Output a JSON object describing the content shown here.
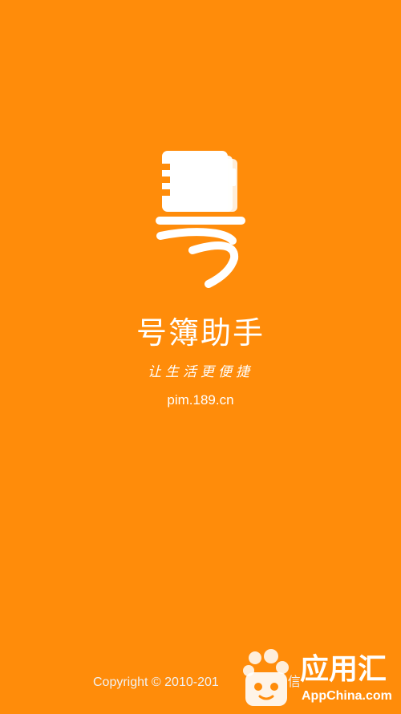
{
  "splash": {
    "logo_icon": "notebook-phone-logo-icon",
    "app_name": "号簿助手",
    "slogan": "让生活更便捷",
    "website": "pim.189.cn",
    "copyright": "Copyright © 2010-201",
    "copyright_tail": "信"
  },
  "watermark": {
    "icon": "appchina-logo-icon",
    "name": "应用汇",
    "site": "AppChina.com"
  },
  "colors": {
    "background": "#FF8C0A",
    "foreground": "#FFFFFF"
  }
}
